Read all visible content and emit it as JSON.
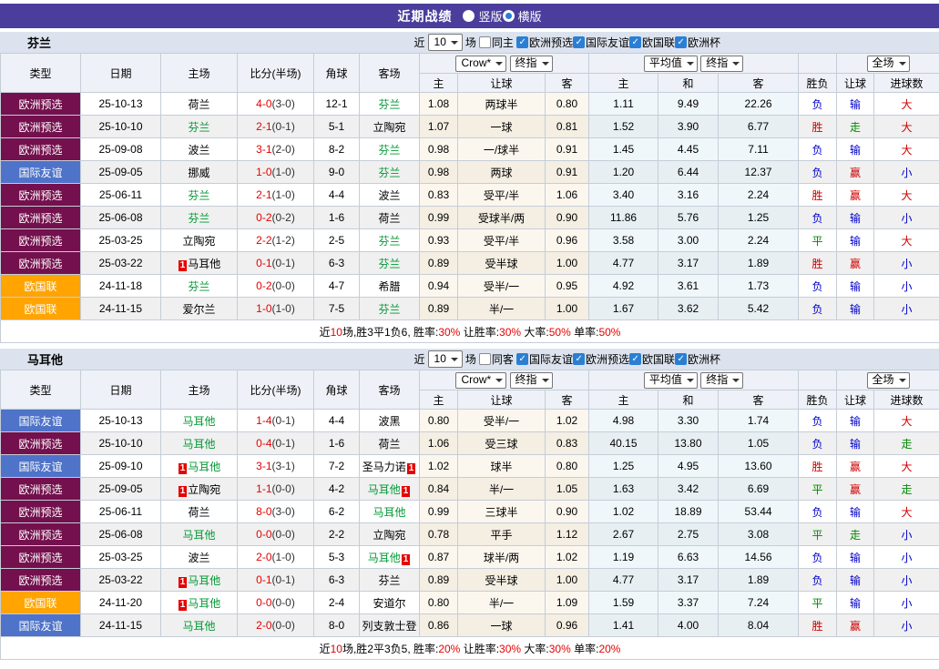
{
  "titlebar": {
    "title": "近期战绩",
    "version_options": [
      {
        "label": "竖版",
        "selected": false
      },
      {
        "label": "横版",
        "selected": true
      }
    ]
  },
  "colors": {
    "topbar_bg": "#4a3d9c",
    "section_bar_bg": "#dce3ee",
    "header_bg": "#eef1f7",
    "radio_dot": "#2a7fd4",
    "checkbox_checked": "#2a7fd4",
    "league": {
      "欧洲预选": "#73104d",
      "国际友谊": "#4e73c8",
      "欧国联": "#ffa400"
    },
    "team_highlight": "#009933",
    "score_red": "#e60000",
    "half_score": "#333333",
    "mark_bg": "#e60000",
    "result": {
      "胜": "#cc0000",
      "平": "#008800",
      "负": "#0000cc",
      "赢": "#cc0000",
      "走": "#008800",
      "输": "#0000cc",
      "大": "#cc0000",
      "小": "#0000cc"
    },
    "summary_red": "#e60000"
  },
  "table_header": {
    "left_cols": [
      "类型",
      "日期",
      "主场",
      "比分(半场)",
      "角球",
      "客场"
    ],
    "sub_cols": [
      "主",
      "让球",
      "客",
      "主",
      "和",
      "客",
      "胜负",
      "让球",
      "进球数"
    ],
    "crow_select": "Crow*",
    "crow_index_select": "终指",
    "avg_select": "平均值",
    "avg_index_select": "终指",
    "scope_select": "全场"
  },
  "sections": [
    {
      "team": "芬兰",
      "filter": {
        "near_label": "近",
        "count_value": "10",
        "games_label": "场",
        "same_venue": {
          "label": "同主",
          "checked": false
        },
        "leagues": [
          {
            "label": "欧洲预选",
            "checked": true
          },
          {
            "label": "国际友谊",
            "checked": true
          },
          {
            "label": "欧国联",
            "checked": true
          },
          {
            "label": "欧洲杯",
            "checked": true
          }
        ]
      },
      "rows": [
        {
          "league": "欧洲预选",
          "date": "25-10-13",
          "home": "荷兰",
          "home_hl": false,
          "home_mark": false,
          "score": "4-0",
          "half": "(3-0)",
          "corners": "12-1",
          "away": "芬兰",
          "away_hl": true,
          "away_mark": false,
          "crow_home": "1.08",
          "handicap": "两球半",
          "crow_away": "0.80",
          "avg_home": "1.11",
          "avg_draw": "9.49",
          "avg_away": "22.26",
          "wdl": "负",
          "handicap_result": "输",
          "goals_result": "大"
        },
        {
          "league": "欧洲预选",
          "date": "25-10-10",
          "home": "芬兰",
          "home_hl": true,
          "home_mark": false,
          "score": "2-1",
          "half": "(0-1)",
          "corners": "5-1",
          "away": "立陶宛",
          "away_hl": false,
          "away_mark": false,
          "crow_home": "1.07",
          "handicap": "一球",
          "crow_away": "0.81",
          "avg_home": "1.52",
          "avg_draw": "3.90",
          "avg_away": "6.77",
          "wdl": "胜",
          "handicap_result": "走",
          "goals_result": "大"
        },
        {
          "league": "欧洲预选",
          "date": "25-09-08",
          "home": "波兰",
          "home_hl": false,
          "home_mark": false,
          "score": "3-1",
          "half": "(2-0)",
          "corners": "8-2",
          "away": "芬兰",
          "away_hl": true,
          "away_mark": false,
          "crow_home": "0.98",
          "handicap": "一/球半",
          "crow_away": "0.91",
          "avg_home": "1.45",
          "avg_draw": "4.45",
          "avg_away": "7.11",
          "wdl": "负",
          "handicap_result": "输",
          "goals_result": "大"
        },
        {
          "league": "国际友谊",
          "date": "25-09-05",
          "home": "挪威",
          "home_hl": false,
          "home_mark": false,
          "score": "1-0",
          "half": "(1-0)",
          "corners": "9-0",
          "away": "芬兰",
          "away_hl": true,
          "away_mark": false,
          "crow_home": "0.98",
          "handicap": "两球",
          "crow_away": "0.91",
          "avg_home": "1.20",
          "avg_draw": "6.44",
          "avg_away": "12.37",
          "wdl": "负",
          "handicap_result": "赢",
          "goals_result": "小"
        },
        {
          "league": "欧洲预选",
          "date": "25-06-11",
          "home": "芬兰",
          "home_hl": true,
          "home_mark": false,
          "score": "2-1",
          "half": "(1-0)",
          "corners": "4-4",
          "away": "波兰",
          "away_hl": false,
          "away_mark": false,
          "crow_home": "0.83",
          "handicap": "受平/半",
          "crow_away": "1.06",
          "avg_home": "3.40",
          "avg_draw": "3.16",
          "avg_away": "2.24",
          "wdl": "胜",
          "handicap_result": "赢",
          "goals_result": "大"
        },
        {
          "league": "欧洲预选",
          "date": "25-06-08",
          "home": "芬兰",
          "home_hl": true,
          "home_mark": false,
          "score": "0-2",
          "half": "(0-2)",
          "corners": "1-6",
          "away": "荷兰",
          "away_hl": false,
          "away_mark": false,
          "crow_home": "0.99",
          "handicap": "受球半/两",
          "crow_away": "0.90",
          "avg_home": "11.86",
          "avg_draw": "5.76",
          "avg_away": "1.25",
          "wdl": "负",
          "handicap_result": "输",
          "goals_result": "小"
        },
        {
          "league": "欧洲预选",
          "date": "25-03-25",
          "home": "立陶宛",
          "home_hl": false,
          "home_mark": false,
          "score": "2-2",
          "half": "(1-2)",
          "corners": "2-5",
          "away": "芬兰",
          "away_hl": true,
          "away_mark": false,
          "crow_home": "0.93",
          "handicap": "受平/半",
          "crow_away": "0.96",
          "avg_home": "3.58",
          "avg_draw": "3.00",
          "avg_away": "2.24",
          "wdl": "平",
          "handicap_result": "输",
          "goals_result": "大"
        },
        {
          "league": "欧洲预选",
          "date": "25-03-22",
          "home": "马耳他",
          "home_hl": false,
          "home_mark": true,
          "score": "0-1",
          "half": "(0-1)",
          "corners": "6-3",
          "away": "芬兰",
          "away_hl": true,
          "away_mark": false,
          "crow_home": "0.89",
          "handicap": "受半球",
          "crow_away": "1.00",
          "avg_home": "4.77",
          "avg_draw": "3.17",
          "avg_away": "1.89",
          "wdl": "胜",
          "handicap_result": "赢",
          "goals_result": "小"
        },
        {
          "league": "欧国联",
          "date": "24-11-18",
          "home": "芬兰",
          "home_hl": true,
          "home_mark": false,
          "score": "0-2",
          "half": "(0-0)",
          "corners": "4-7",
          "away": "希腊",
          "away_hl": false,
          "away_mark": false,
          "crow_home": "0.94",
          "handicap": "受半/一",
          "crow_away": "0.95",
          "avg_home": "4.92",
          "avg_draw": "3.61",
          "avg_away": "1.73",
          "wdl": "负",
          "handicap_result": "输",
          "goals_result": "小"
        },
        {
          "league": "欧国联",
          "date": "24-11-15",
          "home": "爱尔兰",
          "home_hl": false,
          "home_mark": false,
          "score": "1-0",
          "half": "(1-0)",
          "corners": "7-5",
          "away": "芬兰",
          "away_hl": true,
          "away_mark": false,
          "crow_home": "0.89",
          "handicap": "半/一",
          "crow_away": "1.00",
          "avg_home": "1.67",
          "avg_draw": "3.62",
          "avg_away": "5.42",
          "wdl": "负",
          "handicap_result": "输",
          "goals_result": "小"
        }
      ],
      "summary": [
        {
          "text": "近",
          "red": false
        },
        {
          "text": "10",
          "red": true
        },
        {
          "text": "场,胜3平1负6, 胜率:",
          "red": false
        },
        {
          "text": "30%",
          "red": true
        },
        {
          "text": " 让胜率:",
          "red": false
        },
        {
          "text": "30%",
          "red": true
        },
        {
          "text": " 大率:",
          "red": false
        },
        {
          "text": "50%",
          "red": true
        },
        {
          "text": " 单率:",
          "red": false
        },
        {
          "text": "50%",
          "red": true
        }
      ]
    },
    {
      "team": "马耳他",
      "filter": {
        "near_label": "近",
        "count_value": "10",
        "games_label": "场",
        "same_venue": {
          "label": "同客",
          "checked": false
        },
        "leagues": [
          {
            "label": "国际友谊",
            "checked": true
          },
          {
            "label": "欧洲预选",
            "checked": true
          },
          {
            "label": "欧国联",
            "checked": true
          },
          {
            "label": "欧洲杯",
            "checked": true
          }
        ]
      },
      "rows": [
        {
          "league": "国际友谊",
          "date": "25-10-13",
          "home": "马耳他",
          "home_hl": true,
          "home_mark": false,
          "score": "1-4",
          "half": "(0-1)",
          "corners": "4-4",
          "away": "波黑",
          "away_hl": false,
          "away_mark": false,
          "crow_home": "0.80",
          "handicap": "受半/一",
          "crow_away": "1.02",
          "avg_home": "4.98",
          "avg_draw": "3.30",
          "avg_away": "1.74",
          "wdl": "负",
          "handicap_result": "输",
          "goals_result": "大"
        },
        {
          "league": "欧洲预选",
          "date": "25-10-10",
          "home": "马耳他",
          "home_hl": true,
          "home_mark": false,
          "score": "0-4",
          "half": "(0-1)",
          "corners": "1-6",
          "away": "荷兰",
          "away_hl": false,
          "away_mark": false,
          "crow_home": "1.06",
          "handicap": "受三球",
          "crow_away": "0.83",
          "avg_home": "40.15",
          "avg_draw": "13.80",
          "avg_away": "1.05",
          "wdl": "负",
          "handicap_result": "输",
          "goals_result": "走"
        },
        {
          "league": "国际友谊",
          "date": "25-09-10",
          "home": "马耳他",
          "home_hl": true,
          "home_mark": true,
          "score": "3-1",
          "half": "(3-1)",
          "corners": "7-2",
          "away": "圣马力诺",
          "away_hl": false,
          "away_mark": true,
          "crow_home": "1.02",
          "handicap": "球半",
          "crow_away": "0.80",
          "avg_home": "1.25",
          "avg_draw": "4.95",
          "avg_away": "13.60",
          "wdl": "胜",
          "handicap_result": "赢",
          "goals_result": "大"
        },
        {
          "league": "欧洲预选",
          "date": "25-09-05",
          "home": "立陶宛",
          "home_hl": false,
          "home_mark": true,
          "score": "1-1",
          "half": "(0-0)",
          "corners": "4-2",
          "away": "马耳他",
          "away_hl": true,
          "away_mark": true,
          "crow_home": "0.84",
          "handicap": "半/一",
          "crow_away": "1.05",
          "avg_home": "1.63",
          "avg_draw": "3.42",
          "avg_away": "6.69",
          "wdl": "平",
          "handicap_result": "赢",
          "goals_result": "走"
        },
        {
          "league": "欧洲预选",
          "date": "25-06-11",
          "home": "荷兰",
          "home_hl": false,
          "home_mark": false,
          "score": "8-0",
          "half": "(3-0)",
          "corners": "6-2",
          "away": "马耳他",
          "away_hl": true,
          "away_mark": false,
          "crow_home": "0.99",
          "handicap": "三球半",
          "crow_away": "0.90",
          "avg_home": "1.02",
          "avg_draw": "18.89",
          "avg_away": "53.44",
          "wdl": "负",
          "handicap_result": "输",
          "goals_result": "大"
        },
        {
          "league": "欧洲预选",
          "date": "25-06-08",
          "home": "马耳他",
          "home_hl": true,
          "home_mark": false,
          "score": "0-0",
          "half": "(0-0)",
          "corners": "2-2",
          "away": "立陶宛",
          "away_hl": false,
          "away_mark": false,
          "crow_home": "0.78",
          "handicap": "平手",
          "crow_away": "1.12",
          "avg_home": "2.67",
          "avg_draw": "2.75",
          "avg_away": "3.08",
          "wdl": "平",
          "handicap_result": "走",
          "goals_result": "小"
        },
        {
          "league": "欧洲预选",
          "date": "25-03-25",
          "home": "波兰",
          "home_hl": false,
          "home_mark": false,
          "score": "2-0",
          "half": "(1-0)",
          "corners": "5-3",
          "away": "马耳他",
          "away_hl": true,
          "away_mark": true,
          "crow_home": "0.87",
          "handicap": "球半/两",
          "crow_away": "1.02",
          "avg_home": "1.19",
          "avg_draw": "6.63",
          "avg_away": "14.56",
          "wdl": "负",
          "handicap_result": "输",
          "goals_result": "小"
        },
        {
          "league": "欧洲预选",
          "date": "25-03-22",
          "home": "马耳他",
          "home_hl": true,
          "home_mark": true,
          "score": "0-1",
          "half": "(0-1)",
          "corners": "6-3",
          "away": "芬兰",
          "away_hl": false,
          "away_mark": false,
          "crow_home": "0.89",
          "handicap": "受半球",
          "crow_away": "1.00",
          "avg_home": "4.77",
          "avg_draw": "3.17",
          "avg_away": "1.89",
          "wdl": "负",
          "handicap_result": "输",
          "goals_result": "小"
        },
        {
          "league": "欧国联",
          "date": "24-11-20",
          "home": "马耳他",
          "home_hl": true,
          "home_mark": true,
          "score": "0-0",
          "half": "(0-0)",
          "corners": "2-4",
          "away": "安道尔",
          "away_hl": false,
          "away_mark": false,
          "crow_home": "0.80",
          "handicap": "半/一",
          "crow_away": "1.09",
          "avg_home": "1.59",
          "avg_draw": "3.37",
          "avg_away": "7.24",
          "wdl": "平",
          "handicap_result": "输",
          "goals_result": "小"
        },
        {
          "league": "国际友谊",
          "date": "24-11-15",
          "home": "马耳他",
          "home_hl": true,
          "home_mark": false,
          "score": "2-0",
          "half": "(0-0)",
          "corners": "8-0",
          "away": "列支敦士登",
          "away_hl": false,
          "away_mark": false,
          "crow_home": "0.86",
          "handicap": "一球",
          "crow_away": "0.96",
          "avg_home": "1.41",
          "avg_draw": "4.00",
          "avg_away": "8.04",
          "wdl": "胜",
          "handicap_result": "赢",
          "goals_result": "小"
        }
      ],
      "summary": [
        {
          "text": "近",
          "red": false
        },
        {
          "text": "10",
          "red": true
        },
        {
          "text": "场,胜2平3负5, 胜率:",
          "red": false
        },
        {
          "text": "20%",
          "red": true
        },
        {
          "text": " 让胜率:",
          "red": false
        },
        {
          "text": "30%",
          "red": true
        },
        {
          "text": " 大率:",
          "red": false
        },
        {
          "text": "30%",
          "red": true
        },
        {
          "text": " 单率:",
          "red": false
        },
        {
          "text": "20%",
          "red": true
        }
      ]
    }
  ]
}
